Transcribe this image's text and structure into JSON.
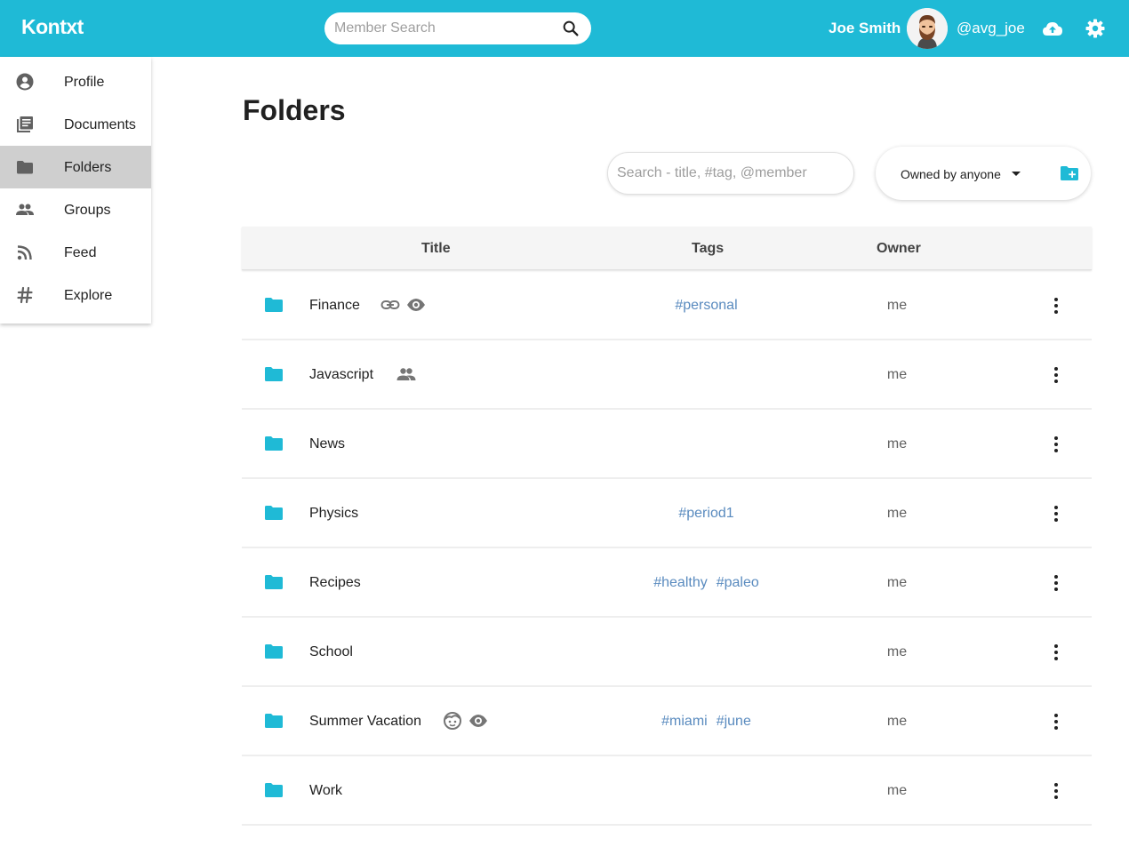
{
  "app": {
    "logo": "Kontxt"
  },
  "header": {
    "search_placeholder": "Member Search",
    "user_name": "Joe Smith",
    "user_handle": "@avg_joe"
  },
  "sidebar": {
    "items": [
      {
        "label": "Profile",
        "icon": "account-circle-icon"
      },
      {
        "label": "Documents",
        "icon": "library-books-icon"
      },
      {
        "label": "Folders",
        "icon": "folder-icon",
        "active": true
      },
      {
        "label": "Groups",
        "icon": "people-icon"
      },
      {
        "label": "Feed",
        "icon": "rss-icon"
      },
      {
        "label": "Explore",
        "icon": "hashtag-icon"
      }
    ]
  },
  "main": {
    "title": "Folders",
    "search_placeholder": "Search - title, #tag, @member",
    "owner_filter": "Owned by anyone",
    "columns": {
      "title": "Title",
      "tags": "Tags",
      "owner": "Owner"
    },
    "rows": [
      {
        "title": "Finance",
        "tags": [
          "#personal"
        ],
        "owner": "me",
        "badges": [
          "link-icon",
          "eye-icon"
        ]
      },
      {
        "title": "Javascript",
        "tags": [],
        "owner": "me",
        "badges": [
          "people-icon"
        ]
      },
      {
        "title": "News",
        "tags": [],
        "owner": "me",
        "badges": []
      },
      {
        "title": "Physics",
        "tags": [
          "#period1"
        ],
        "owner": "me",
        "badges": []
      },
      {
        "title": "Recipes",
        "tags": [
          "#healthy",
          "#paleo"
        ],
        "owner": "me",
        "badges": []
      },
      {
        "title": "School",
        "tags": [],
        "owner": "me",
        "badges": []
      },
      {
        "title": "Summer Vacation",
        "tags": [
          "#miami",
          "#june"
        ],
        "owner": "me",
        "badges": [
          "face-icon",
          "eye-icon"
        ]
      },
      {
        "title": "Work",
        "tags": [],
        "owner": "me",
        "badges": []
      }
    ]
  },
  "colors": {
    "brand": "#1fbad6",
    "tag": "#5a8bbf",
    "active_nav": "#cfcfcf"
  }
}
